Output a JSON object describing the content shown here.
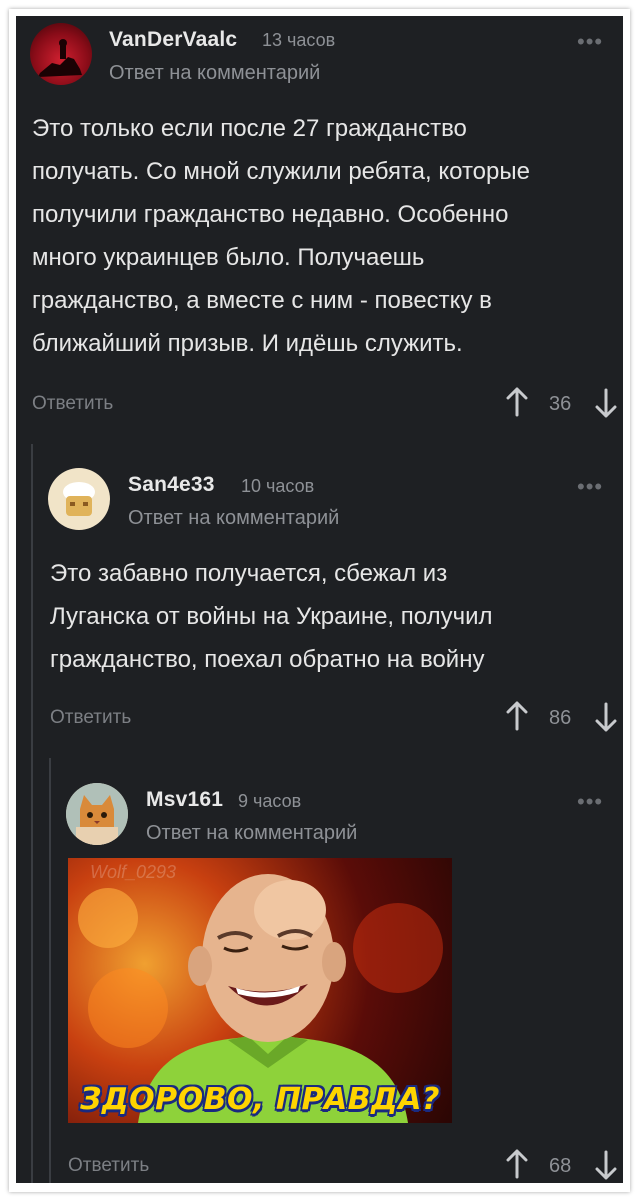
{
  "comments": [
    {
      "author": "VanDerVaalc",
      "time": "13 часов",
      "reply_to": "Ответ на комментарий",
      "text_lines": [
        "Это только если после 27 гражданство",
        "получать. Со мной служили ребята, которые",
        "получили гражданство недавно. Особенно",
        "много украинцев было. Получаешь",
        "гражданство, а вместе с ним - повестку в",
        "ближайший призыв. И идёшь служить."
      ],
      "reply_label": "Ответить",
      "score": "36",
      "menu": "•••"
    },
    {
      "author": "San4e33",
      "time": "10 часов",
      "reply_to": "Ответ на комментарий",
      "text_lines": [
        "Это забавно получается, сбежал из",
        "Луганска от войны на Украине, получил",
        "гражданство, поехал обратно на войну"
      ],
      "reply_label": "Ответить",
      "score": "86",
      "menu": "•••"
    },
    {
      "author": "Msv161",
      "time": "9 часов",
      "reply_to": "Ответ на комментарий",
      "meme_caption": "ЗДОРОВО, ПРАВДА?",
      "meme_watermark": "Wolf_0293",
      "reply_label": "Ответить",
      "score": "68",
      "menu": "•••"
    }
  ],
  "colors": {
    "background": "#1e2023",
    "text": "#e6e6e6",
    "muted": "#8e9196",
    "caption": "#ffd400"
  },
  "icons": [
    "upvote-arrow-icon",
    "downvote-arrow-icon",
    "more-dots-icon"
  ]
}
